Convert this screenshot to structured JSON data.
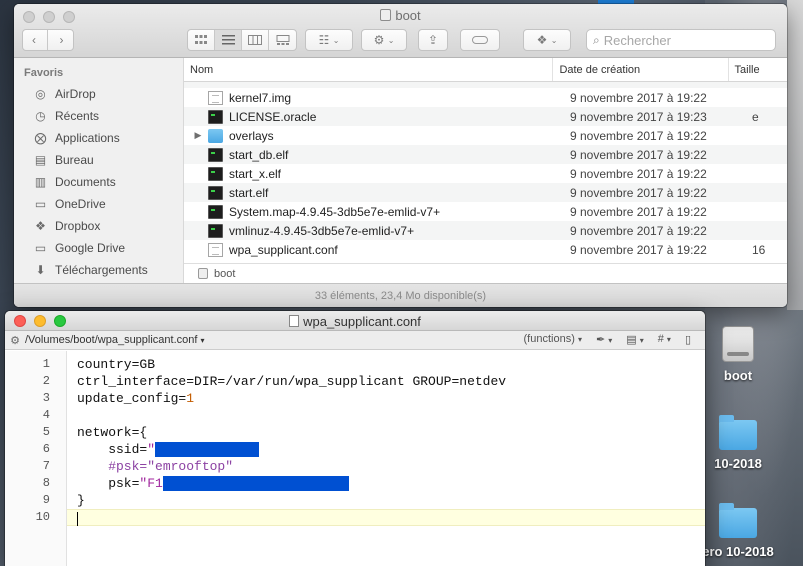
{
  "desktop": {
    "icons": [
      {
        "label": "boot",
        "kind": "drive"
      },
      {
        "label": "10-2018",
        "kind": "folder"
      },
      {
        "label": "ero 10-2018",
        "kind": "folder"
      }
    ]
  },
  "finder": {
    "title": "boot",
    "search_placeholder": "Rechercher",
    "sidebar": {
      "heading": "Favoris",
      "items": [
        {
          "label": "AirDrop",
          "icon": "airdrop-icon"
        },
        {
          "label": "Récents",
          "icon": "clock-icon"
        },
        {
          "label": "Applications",
          "icon": "applications-icon"
        },
        {
          "label": "Bureau",
          "icon": "desktop-icon"
        },
        {
          "label": "Documents",
          "icon": "documents-icon"
        },
        {
          "label": "OneDrive",
          "icon": "folder-icon"
        },
        {
          "label": "Dropbox",
          "icon": "dropbox-icon"
        },
        {
          "label": "Google Drive",
          "icon": "folder-icon"
        },
        {
          "label": "Téléchargements",
          "icon": "download-icon"
        }
      ]
    },
    "columns": {
      "name": "Nom",
      "date": "Date de création",
      "size": "Taille"
    },
    "rows": [
      {
        "name": "kernel7.img",
        "date": "9 novembre 2017 à 19:22",
        "size": "",
        "type": "doc"
      },
      {
        "name": "LICENSE.oracle",
        "date": "9 novembre 2017 à 19:23",
        "size": "e",
        "type": "exec"
      },
      {
        "name": "overlays",
        "date": "9 novembre 2017 à 19:22",
        "size": "",
        "type": "folder"
      },
      {
        "name": "start_db.elf",
        "date": "9 novembre 2017 à 19:22",
        "size": "",
        "type": "exec"
      },
      {
        "name": "start_x.elf",
        "date": "9 novembre 2017 à 19:22",
        "size": "",
        "type": "exec"
      },
      {
        "name": "start.elf",
        "date": "9 novembre 2017 à 19:22",
        "size": "",
        "type": "exec"
      },
      {
        "name": "System.map-4.9.45-3db5e7e-emlid-v7+",
        "date": "9 novembre 2017 à 19:22",
        "size": "",
        "type": "exec"
      },
      {
        "name": "vmlinuz-4.9.45-3db5e7e-emlid-v7+",
        "date": "9 novembre 2017 à 19:22",
        "size": "",
        "type": "exec"
      },
      {
        "name": "wpa_supplicant.conf",
        "date": "9 novembre 2017 à 19:22",
        "size": "16",
        "type": "doc"
      }
    ],
    "pathbar": "boot",
    "status": "33 éléments, 23,4 Mo disponible(s)"
  },
  "editor": {
    "title": "wpa_supplicant.conf",
    "path": "/Volumes/boot/wpa_supplicant.conf",
    "functions_label": "(functions)",
    "hash_label": "#",
    "line_numbers": [
      "1",
      "2",
      "3",
      "4",
      "5",
      "6",
      "7",
      "8",
      "9",
      "10"
    ],
    "lines": {
      "l1": "country=GB",
      "l2": "ctrl_interface=DIR=/var/run/wpa_supplicant GROUP=netdev",
      "l3_key": "update_config=",
      "l3_val": "1",
      "l5": "network={",
      "l6_key": "    ssid=",
      "l6_quote": "\"",
      "l7": "    #psk=\"emrooftop\"",
      "l8_key": "    psk=",
      "l8_val": "\"F1",
      "l9": "}"
    }
  }
}
